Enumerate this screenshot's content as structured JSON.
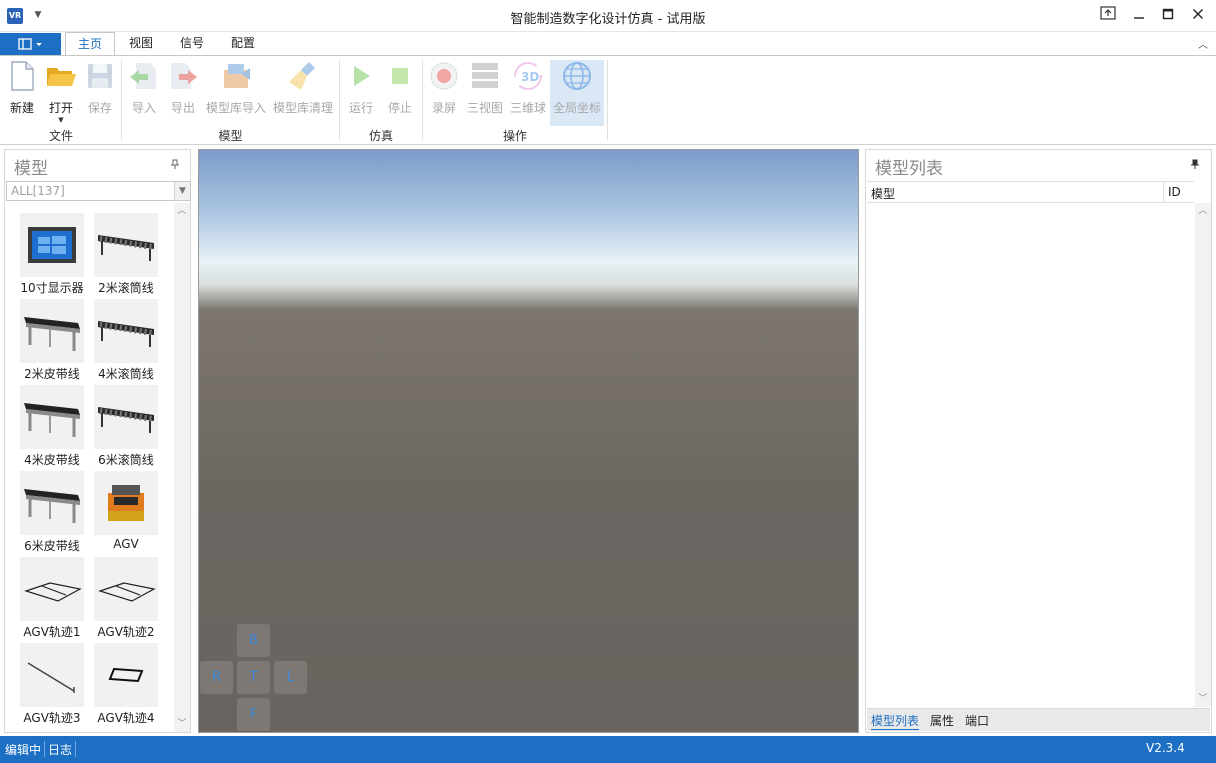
{
  "window": {
    "title": "智能制造数字化设计仿真 - 试用版",
    "app_icon_text": "VR"
  },
  "ribbon": {
    "tabs": [
      {
        "label": "主页",
        "active": true
      },
      {
        "label": "视图",
        "active": false
      },
      {
        "label": "信号",
        "active": false
      },
      {
        "label": "配置",
        "active": false
      }
    ],
    "groups": {
      "file": {
        "label": "文件",
        "buttons": [
          {
            "label": "新建",
            "icon": "new-file-icon",
            "enabled": true
          },
          {
            "label": "打开",
            "icon": "open-folder-icon",
            "enabled": true
          },
          {
            "label": "保存",
            "icon": "save-disk-icon",
            "enabled": false
          }
        ]
      },
      "model": {
        "label": "模型",
        "buttons": [
          {
            "label": "导入",
            "icon": "import-icon",
            "enabled": false
          },
          {
            "label": "导出",
            "icon": "export-icon",
            "enabled": false
          },
          {
            "label": "模型库导入",
            "icon": "library-import-icon",
            "enabled": false
          },
          {
            "label": "模型库清理",
            "icon": "broom-icon",
            "enabled": false
          }
        ]
      },
      "simulation": {
        "label": "仿真",
        "buttons": [
          {
            "label": "运行",
            "icon": "play-icon",
            "enabled": false
          },
          {
            "label": "停止",
            "icon": "stop-icon",
            "enabled": false
          }
        ]
      },
      "operation": {
        "label": "操作",
        "buttons": [
          {
            "label": "录屏",
            "icon": "record-icon",
            "enabled": false
          },
          {
            "label": "三视图",
            "icon": "three-view-icon",
            "enabled": false
          },
          {
            "label": "三维球",
            "icon": "3d-sphere-icon",
            "enabled": false
          },
          {
            "label": "全局坐标",
            "icon": "globe-icon",
            "enabled": false,
            "selected": true
          }
        ]
      }
    }
  },
  "left_panel": {
    "title": "模型",
    "filter_value": "ALL[137]",
    "items": [
      {
        "label": "10寸显示器",
        "thumb": "monitor"
      },
      {
        "label": "2米滚筒线",
        "thumb": "roller"
      },
      {
        "label": "2米皮带线",
        "thumb": "belt"
      },
      {
        "label": "4米滚筒线",
        "thumb": "roller"
      },
      {
        "label": "4米皮带线",
        "thumb": "belt"
      },
      {
        "label": "6米滚筒线",
        "thumb": "roller"
      },
      {
        "label": "6米皮带线",
        "thumb": "belt"
      },
      {
        "label": "AGV",
        "thumb": "agv"
      },
      {
        "label": "AGV轨迹1",
        "thumb": "track"
      },
      {
        "label": "AGV轨迹2",
        "thumb": "track"
      },
      {
        "label": "AGV轨迹3",
        "thumb": "track-line"
      },
      {
        "label": "AGV轨迹4",
        "thumb": "track-rect"
      }
    ]
  },
  "viewport": {
    "nav": {
      "top": "B",
      "left": "R",
      "center": "T",
      "right": "L",
      "bottom": "F"
    }
  },
  "right_panel": {
    "title": "模型列表",
    "columns": [
      "模型",
      "ID"
    ],
    "tabs": [
      {
        "label": "模型列表",
        "active": true
      },
      {
        "label": "属性",
        "active": false
      },
      {
        "label": "端口",
        "active": false
      }
    ]
  },
  "status": {
    "mode": "编辑中",
    "log": "日志",
    "version": "V2.3.4"
  },
  "colors": {
    "accent": "#1c6fc3",
    "status_bar": "#1c6fc3"
  }
}
